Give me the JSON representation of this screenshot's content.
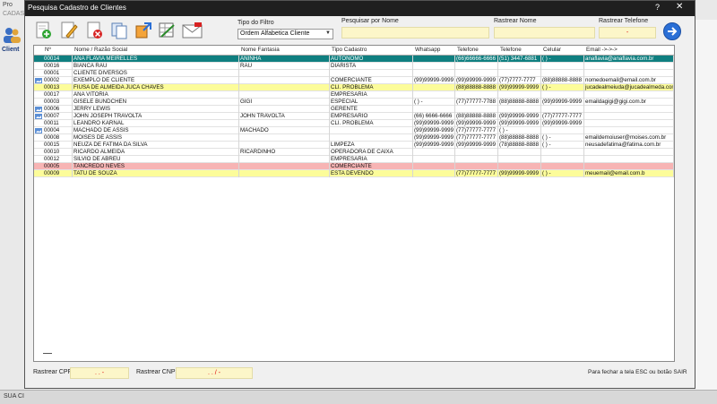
{
  "background": {
    "app_title": "Pro",
    "app_menu": "CADAS",
    "clientes_label": "Client",
    "status_text": "SUA CI"
  },
  "window": {
    "title": "Pesquisa Cadastro de Clientes",
    "help": "?",
    "close": "✕"
  },
  "filters": {
    "tipo_label": "Tipo do Filtro",
    "tipo_value": "Ordem Alfabetica Cliente",
    "nome_label": "Pesquisar por Nome",
    "rastrear_nome_label": "Rastrear Nome",
    "rastrear_tel_label": "Rastrear Telefone",
    "rastrear_tel_value": "-"
  },
  "columns": [
    "Nº",
    "Nome / Razão Social",
    "Nome Fantasia",
    "Tipo Cadastro",
    "Whatsapp",
    "Telefone",
    "Telefone",
    "Celular",
    "Email ->->->"
  ],
  "rows": [
    {
      "id": "00014",
      "nome": "ANA FLAVIA MEIRELLES",
      "fantasia": "ANINHA",
      "tipo": "AUTONOMO",
      "whats": "",
      "tel1": "(66)66666-6666",
      "tel2": "(51) 3447-6881",
      "cel": "(  )    -",
      "email": "anaflavia@anaflavia.com.br",
      "style": "selected",
      "mark": false
    },
    {
      "id": "00016",
      "nome": "BIANCA RAU",
      "fantasia": "RAU",
      "tipo": "DIARISTA",
      "whats": "",
      "tel1": "",
      "tel2": "",
      "cel": "",
      "email": "",
      "style": "normal",
      "mark": false
    },
    {
      "id": "00001",
      "nome": "CLIENTE DIVERSOS",
      "fantasia": "",
      "tipo": "",
      "whats": "",
      "tel1": "",
      "tel2": "",
      "cel": "",
      "email": "",
      "style": "normal",
      "mark": false
    },
    {
      "id": "00002",
      "nome": "EXEMPLO DE CLIENTE",
      "fantasia": "",
      "tipo": "COMERCIANTE",
      "whats": "(99)99999-9999",
      "tel1": "(99)99999-9999",
      "tel2": "(77)7777-7777",
      "cel": "(88)88888-8888",
      "email": "nomedoemail@email.com.br",
      "style": "normal",
      "mark": true
    },
    {
      "id": "00013",
      "nome": "FIUSA DE ALMEIDA JUCA CHAVES",
      "fantasia": "",
      "tipo": "CLI. PROBLEMA",
      "whats": "",
      "tel1": "(88)88888-8888",
      "tel2": "(99)99999-9999",
      "cel": "(  )    -",
      "email": "jucadealmeiuda@jucadealmeda.com.br",
      "style": "yellow",
      "mark": false
    },
    {
      "id": "00017",
      "nome": "ANA VITORIA",
      "fantasia": "",
      "tipo": "EMPRESARIA",
      "whats": "",
      "tel1": "",
      "tel2": "",
      "cel": "",
      "email": "",
      "style": "normal",
      "mark": false
    },
    {
      "id": "00003",
      "nome": "GISELE BUNDCHEN",
      "fantasia": "GIGI",
      "tipo": "ESPECIAL",
      "whats": "(  )    -",
      "tel1": "(77)77777-7788",
      "tel2": "(88)88888-8888",
      "cel": "(99)99999-9999",
      "email": "emaildagigi@gigi.com.br",
      "style": "normal",
      "mark": false
    },
    {
      "id": "00006",
      "nome": "JERRY LEWIS",
      "fantasia": "",
      "tipo": "GERENTE",
      "whats": "",
      "tel1": "",
      "tel2": "",
      "cel": "",
      "email": "",
      "style": "normal",
      "mark": true
    },
    {
      "id": "00007",
      "nome": "JOHN JOSEPH TRAVOLTA",
      "fantasia": "JOHN TRAVOLTA",
      "tipo": "EMPRESARIO",
      "whats": "(66) 6666-6666",
      "tel1": "(88)88888-8888",
      "tel2": "(99)99999-9999",
      "cel": "(77)77777-7777",
      "email": "",
      "style": "normal",
      "mark": true
    },
    {
      "id": "00011",
      "nome": "LEANDRO KARNAL",
      "fantasia": "",
      "tipo": "CLI. PROBLEMA",
      "whats": "(99)99999-9999",
      "tel1": "(99)99999-9999",
      "tel2": "(99)99999-9999",
      "cel": "(99)99999-9999",
      "email": "",
      "style": "normal",
      "mark": false
    },
    {
      "id": "00004",
      "nome": "MACHADO DE ASSIS",
      "fantasia": "MACHADO",
      "tipo": "",
      "whats": "(99)99999-9999",
      "tel1": "(77)77777-7777",
      "tel2": "(  )    -",
      "cel": "",
      "email": "",
      "style": "normal",
      "mark": true
    },
    {
      "id": "00008",
      "nome": "MOISES DE ASSIS",
      "fantasia": "",
      "tipo": "",
      "whats": "(99)99999-9999",
      "tel1": "(77)77777-7777",
      "tel2": "(88)88888-8888",
      "cel": "(  )    -",
      "email": "emaildemoiuser@moises.com.br",
      "style": "normal",
      "mark": false
    },
    {
      "id": "00015",
      "nome": "NEUZA DE FATIMA DA SILVA",
      "fantasia": "",
      "tipo": "LIMPEZA",
      "whats": "(99)99999-9999",
      "tel1": "(99)99999-9999",
      "tel2": "(78)88888-8888",
      "cel": "(  )    -",
      "email": "neusadefatima@fatima.com.br",
      "style": "normal",
      "mark": false
    },
    {
      "id": "00010",
      "nome": "RICARDO ALMEIDA",
      "fantasia": "RICARDINHO",
      "tipo": "OPERADORA DE CAIXA",
      "whats": "",
      "tel1": "",
      "tel2": "",
      "cel": "",
      "email": "",
      "style": "normal",
      "mark": false
    },
    {
      "id": "00012",
      "nome": "SILVIO DE ABREU",
      "fantasia": "",
      "tipo": "EMPRESARIA",
      "whats": "",
      "tel1": "",
      "tel2": "",
      "cel": "",
      "email": "",
      "style": "normal",
      "mark": false
    },
    {
      "id": "00005",
      "nome": "TANCREDO NEVES",
      "fantasia": "",
      "tipo": "COMERCIANTE",
      "whats": "",
      "tel1": "",
      "tel2": "",
      "cel": "",
      "email": "",
      "style": "pink",
      "mark": false
    },
    {
      "id": "00009",
      "nome": "TATU DE SOUZA",
      "fantasia": "",
      "tipo": "ESTA DEVENDO",
      "whats": "",
      "tel1": "(77)77777-7777",
      "tel2": "(99)99999-9999",
      "cel": "(  )    -",
      "email": "meuemail@email.com.b",
      "style": "yellow",
      "mark": false
    }
  ],
  "footer": {
    "cpf_label": "Rastrear CPF",
    "cpf_value": ".   .   -",
    "cnpj_label": "Rastrear CNPJ",
    "cnpj_value": ".   .   /   -",
    "hint": "Para fechar a tela ESC ou botão SAIR"
  },
  "colors": {
    "selected_row": "#0f7f80",
    "yellow_row": "#fcfc9a",
    "pink_row": "#f7b4b4",
    "input_bg": "#fcf6c9"
  }
}
